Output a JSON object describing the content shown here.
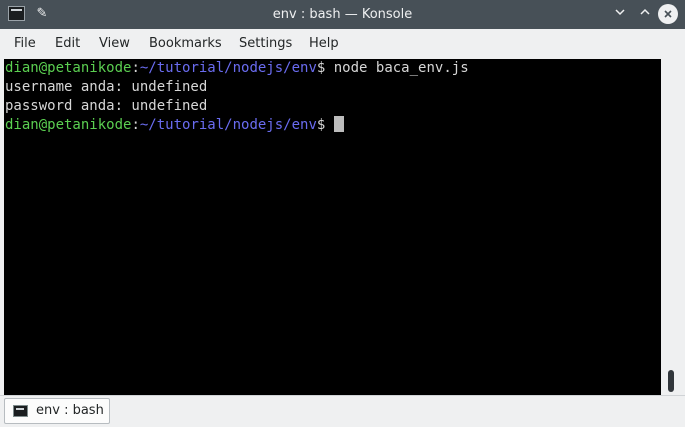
{
  "window": {
    "title": "env : bash — Konsole",
    "icons": {
      "app": "terminal-icon",
      "pin": "pin-icon",
      "minimize": "chevron-down-icon",
      "maximize": "chevron-up-icon",
      "close": "close-icon"
    }
  },
  "menu": {
    "items": [
      "File",
      "Edit",
      "View",
      "Bookmarks",
      "Settings",
      "Help"
    ]
  },
  "terminal": {
    "lines": [
      {
        "user_host": "dian@petanikode",
        "sep": ":",
        "path": "~/tutorial/nodejs/env",
        "prompt": "$",
        "command": " node baca_env.js"
      },
      {
        "text": "username anda: undefined"
      },
      {
        "text": "password anda: undefined"
      },
      {
        "user_host": "dian@petanikode",
        "sep": ":",
        "path": "~/tutorial/nodejs/env",
        "prompt": "$",
        "command": " "
      }
    ],
    "colors": {
      "user_host": "#5bcf51",
      "path": "#6a6cf0",
      "text": "#d6d6d6",
      "background": "#000000"
    }
  },
  "tabs": [
    {
      "label": "env : bash",
      "icon": "terminal-icon"
    }
  ]
}
